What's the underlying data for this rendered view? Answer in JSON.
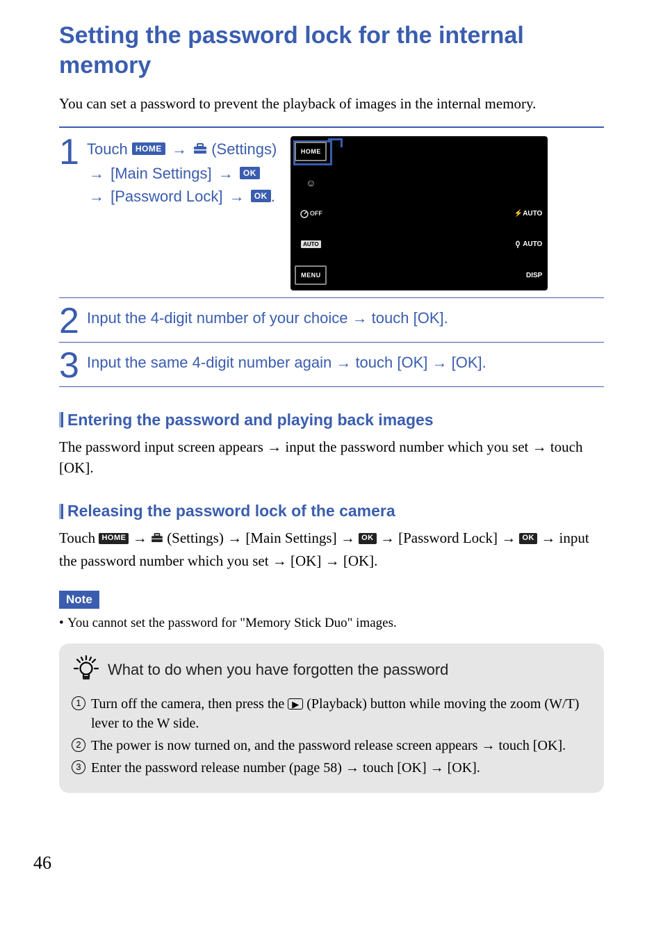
{
  "title": "Setting the password lock for the internal memory",
  "intro": "You can set a password to prevent the playback of images in the internal memory.",
  "steps": {
    "s1": {
      "num": "1",
      "t1": "Touch ",
      "home": "HOME",
      "t2": " (Settings) ",
      "t3": " [Main Settings] ",
      "ok": "OK",
      "t4": " [Password Lock] ",
      "t5": "."
    },
    "s2": {
      "num": "2",
      "text": "Input the 4-digit number of your choice → touch [OK]."
    },
    "s3": {
      "num": "3",
      "text": "Input the same 4-digit number again → touch [OK] → [OK]."
    }
  },
  "screen": {
    "home": "HOME",
    "menu": "MENU",
    "off": "OFF",
    "auto": "AUTO",
    "fauto": "AUTO",
    "jauto": "AUTO",
    "disp": "DISP"
  },
  "sub1": {
    "title": "Entering the password and playing back images",
    "body": "The password input screen appears → input the password number which you set → touch [OK]."
  },
  "sub2": {
    "title": "Releasing the password lock of the camera",
    "b1": "Touch ",
    "home": "HOME",
    "b2": " (Settings) → [Main Settings] → ",
    "ok": "OK",
    "b3": " → [Password Lock] → ",
    "b4": " → input the password number which you set → [OK] → [OK]."
  },
  "note": {
    "label": "Note",
    "item": "You cannot set the password for \"Memory Stick Duo\" images."
  },
  "hint": {
    "title": "What to do when you have forgotten the password",
    "items": {
      "i1a": "Turn off the camera, then press the ",
      "i1b": " (Playback) button while moving the zoom (W/T) lever to the W side.",
      "i2": "The power is now turned on, and the password release screen appears → touch [OK].",
      "i3": "Enter the password release number (page 58) → touch [OK] → [OK]."
    },
    "nums": {
      "n1": "1",
      "n2": "2",
      "n3": "3"
    }
  },
  "page": "46"
}
